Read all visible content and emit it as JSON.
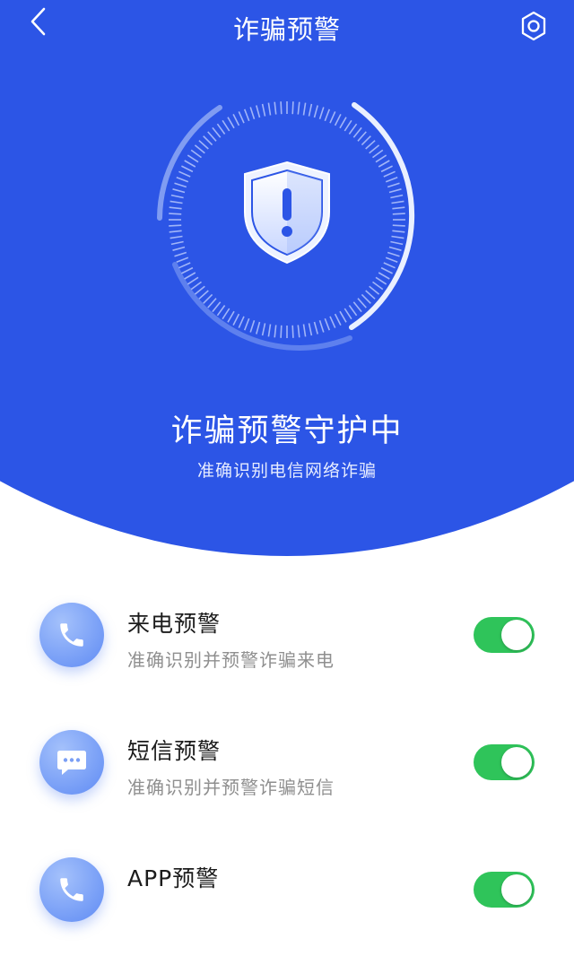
{
  "header": {
    "title": "诈骗预警",
    "back_icon": "chevron-left-icon",
    "settings_icon": "gear-icon"
  },
  "status": {
    "title": "诈骗预警守护中",
    "subtitle": "准确识别电信网络诈骗",
    "icon": "shield-alert-icon"
  },
  "features": [
    {
      "title": "来电预警",
      "description": "准确识别并预警诈骗来电",
      "icon": "phone-icon",
      "enabled": true
    },
    {
      "title": "短信预警",
      "description": "准确识别并预警诈骗短信",
      "icon": "message-icon",
      "enabled": true
    },
    {
      "title": "APP预警",
      "description": "",
      "icon": "phone-icon",
      "enabled": true
    }
  ],
  "colors": {
    "primary": "#2c55e6",
    "toggle_on": "#2fc45a",
    "title_text": "#1c1c1c",
    "desc_text": "#8f8f8f"
  }
}
